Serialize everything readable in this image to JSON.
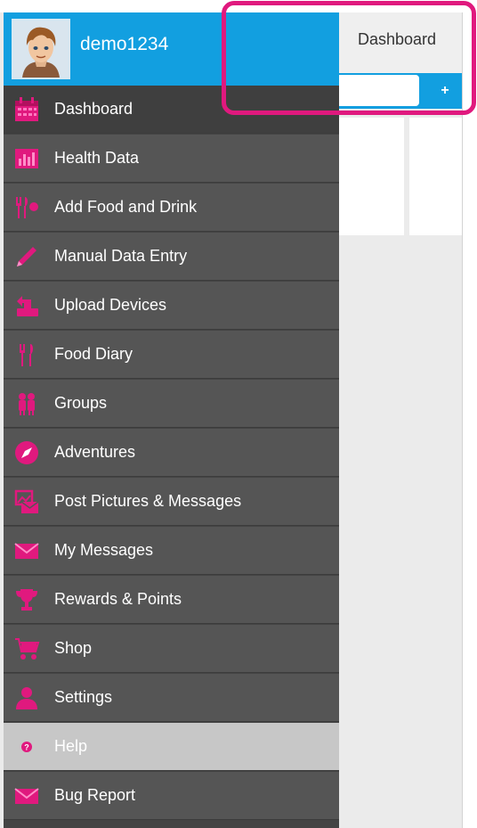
{
  "app": {
    "title": "Dashboard",
    "add_label": "+"
  },
  "user": {
    "name": "demo1234"
  },
  "menu": {
    "items": [
      {
        "label": "Dashboard",
        "icon": "calendar-icon"
      },
      {
        "label": "Health Data",
        "icon": "chart-icon"
      },
      {
        "label": "Add Food and Drink",
        "icon": "fork-knife-icon"
      },
      {
        "label": "Manual Data Entry",
        "icon": "pencil-icon"
      },
      {
        "label": "Upload Devices",
        "icon": "upload-device-icon"
      },
      {
        "label": "Food Diary",
        "icon": "cutlery-icon"
      },
      {
        "label": "Groups",
        "icon": "people-icon"
      },
      {
        "label": "Adventures",
        "icon": "compass-icon"
      },
      {
        "label": "Post Pictures & Messages",
        "icon": "picture-icon"
      },
      {
        "label": "My Messages",
        "icon": "envelope-icon"
      },
      {
        "label": "Rewards & Points",
        "icon": "trophy-icon"
      },
      {
        "label": "Shop",
        "icon": "cart-icon"
      },
      {
        "label": "Settings",
        "icon": "person-icon"
      },
      {
        "label": "Help",
        "icon": "question-icon"
      },
      {
        "label": "Bug Report",
        "icon": "envelope-icon"
      }
    ]
  },
  "colors": {
    "accent_blue": "#129fe0",
    "icon_pink": "#e0197e",
    "menu_bg": "#555555",
    "menu_active": "#3f3f3f",
    "help_bg": "#c7c7c7",
    "highlight": "#e0197e"
  }
}
